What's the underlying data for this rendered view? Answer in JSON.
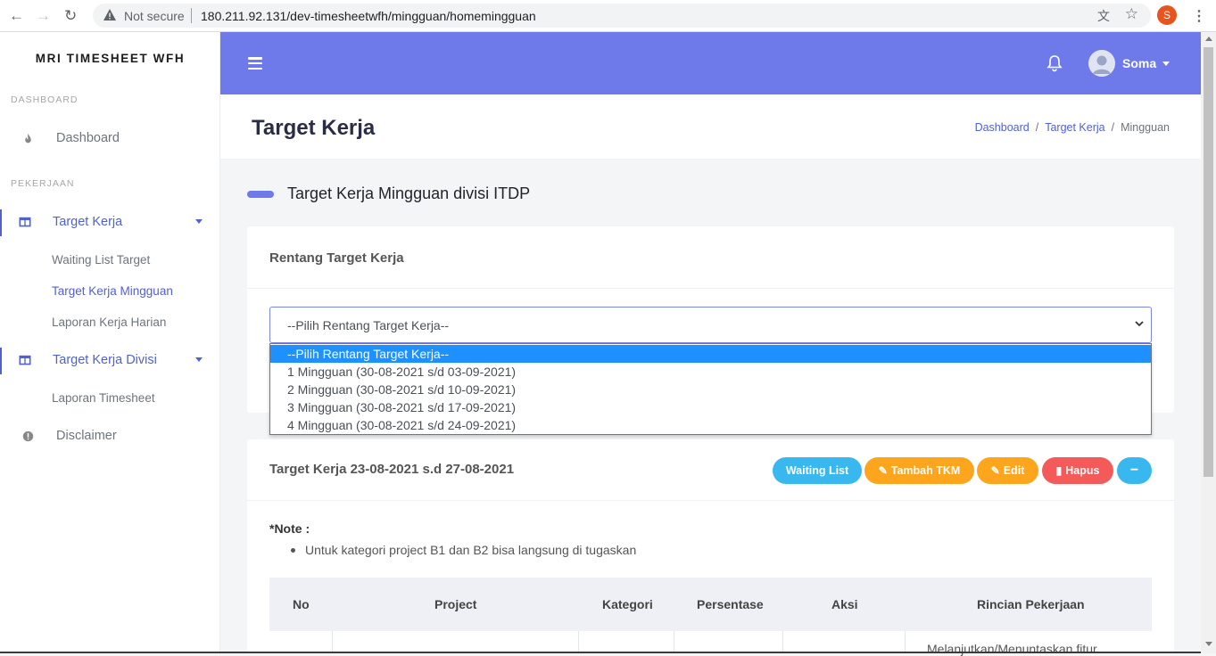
{
  "browser": {
    "security_label": "Not secure",
    "url": "180.211.92.131/dev-timesheetwfh/mingguan/homemingguan",
    "profile_initial": "S"
  },
  "sidebar": {
    "brand": "MRI TIMESHEET WFH",
    "section_dashboard": "DASHBOARD",
    "dashboard_label": "Dashboard",
    "section_pekerjaan": "PEKERJAAN",
    "target_kerja_label": "Target Kerja",
    "sub_waiting": "Waiting List Target",
    "sub_mingguan": "Target Kerja Mingguan",
    "sub_harian": "Laporan Kerja Harian",
    "target_divisi_label": "Target Kerja Divisi",
    "sub_timesheet": "Laporan Timesheet",
    "disclaimer_label": "Disclaimer"
  },
  "topbar": {
    "username": "Soma"
  },
  "header": {
    "title": "Target Kerja",
    "breadcrumb": [
      "Dashboard",
      "Target Kerja",
      "Mingguan"
    ]
  },
  "section_title": "Target Kerja Mingguan divisi ITDP",
  "range_card": {
    "title": "Rentang Target Kerja",
    "select_value": "--Pilih Rentang Target Kerja--",
    "options": [
      "--Pilih Rentang Target Kerja--",
      "1 Mingguan (30-08-2021 s/d 03-09-2021)",
      "2 Mingguan (30-08-2021 s/d 10-09-2021)",
      "3 Mingguan (30-08-2021 s/d 17-09-2021)",
      "4 Mingguan (30-08-2021 s/d 24-09-2021)"
    ]
  },
  "target_card": {
    "title": "Target Kerja 23-08-2021 s.d 27-08-2021",
    "buttons": {
      "waiting": "Waiting List",
      "tambah": "Tambah TKM",
      "edit": "Edit",
      "hapus": "Hapus"
    },
    "note_title": "*Note :",
    "note_items": [
      "Untuk kategori project B1 dan B2 bisa langsung di tugaskan"
    ],
    "columns": [
      "No",
      "Project",
      "Kategori",
      "Persentase",
      "Aksi",
      "Rincian Pekerjaan"
    ],
    "first_row_partial": "Melanjutkan/Menuntaskan fitur"
  },
  "colors": {
    "accent": "#6e7aea",
    "link": "#5161ce",
    "info": "#39b8ef",
    "warning": "#fda51d",
    "danger": "#f55a5a"
  }
}
